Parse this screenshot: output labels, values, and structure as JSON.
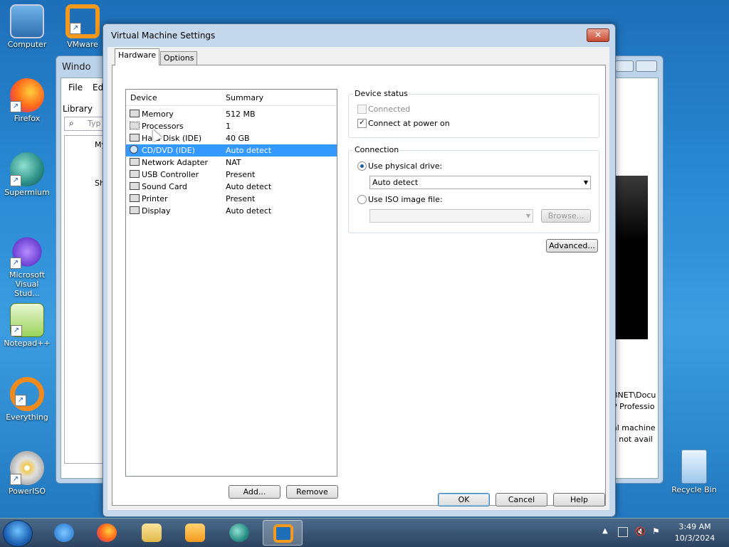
{
  "desktop": {
    "icons": [
      {
        "label": "Computer"
      },
      {
        "label": "VMware"
      },
      {
        "label": "Firefox"
      },
      {
        "label": "Supermium"
      },
      {
        "label": "Microsoft Visual Stud..."
      },
      {
        "label": "Notepad++"
      },
      {
        "label": "Everything"
      },
      {
        "label": "PowerISO"
      },
      {
        "label": "Recycle Bin"
      }
    ]
  },
  "background_window": {
    "title": "Windo",
    "menu": [
      "File",
      "Edi"
    ],
    "library_label": "Library",
    "search_placeholder": "Typ",
    "tree": [
      "My",
      "Sh"
    ],
    "right_text": [
      "BNET\\Docu",
      "P Professio",
      "al machine",
      "s not avail"
    ]
  },
  "dialog": {
    "title": "Virtual Machine Settings",
    "close_symbol": "✕",
    "tabs": [
      {
        "label": "Hardware"
      },
      {
        "label": "Options"
      }
    ],
    "device_list": {
      "header_device": "Device",
      "header_summary": "Summary",
      "rows": [
        {
          "device": "Memory",
          "summary": "512 MB"
        },
        {
          "device": "Processors",
          "summary": "1"
        },
        {
          "device": "Hard Disk (IDE)",
          "summary": "40 GB"
        },
        {
          "device": "CD/DVD (IDE)",
          "summary": "Auto detect"
        },
        {
          "device": "Network Adapter",
          "summary": "NAT"
        },
        {
          "device": "USB Controller",
          "summary": "Present"
        },
        {
          "device": "Sound Card",
          "summary": "Auto detect"
        },
        {
          "device": "Printer",
          "summary": "Present"
        },
        {
          "device": "Display",
          "summary": "Auto detect"
        }
      ]
    },
    "add_label": "Add...",
    "remove_label": "Remove",
    "device_status": {
      "title": "Device status",
      "connected_label": "Connected",
      "connect_power_on_label": "Connect at power on"
    },
    "connection": {
      "title": "Connection",
      "physical_label": "Use physical drive:",
      "physical_value": "Auto detect",
      "iso_label": "Use ISO image file:",
      "iso_value": "",
      "browse_label": "Browse..."
    },
    "advanced_label": "Advanced...",
    "ok_label": "OK",
    "cancel_label": "Cancel",
    "help_label": "Help"
  },
  "taskbar": {
    "time": "3:49 AM",
    "date": "10/3/2024"
  }
}
